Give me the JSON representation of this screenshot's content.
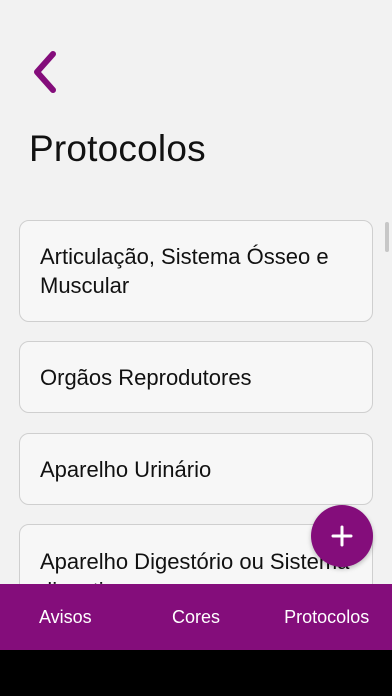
{
  "colors": {
    "accent": "#840d7b",
    "background": "#f2f2f2",
    "card_background": "#f7f7f7",
    "card_border": "#cfcfcf",
    "text": "#111111",
    "nav_text": "#ffffff"
  },
  "header": {
    "back_icon": "chevron-left-icon",
    "title": "Protocolos"
  },
  "protocols": [
    "Articulação, Sistema Ósseo e Muscular",
    "Orgãos Reprodutores",
    "Aparelho Urinário",
    "Aparelho Digestório ou Sistema digestivo"
  ],
  "fab": {
    "icon": "plus-icon"
  },
  "bottom_nav": {
    "items": [
      "Avisos",
      "Cores",
      "Protocolos"
    ]
  }
}
